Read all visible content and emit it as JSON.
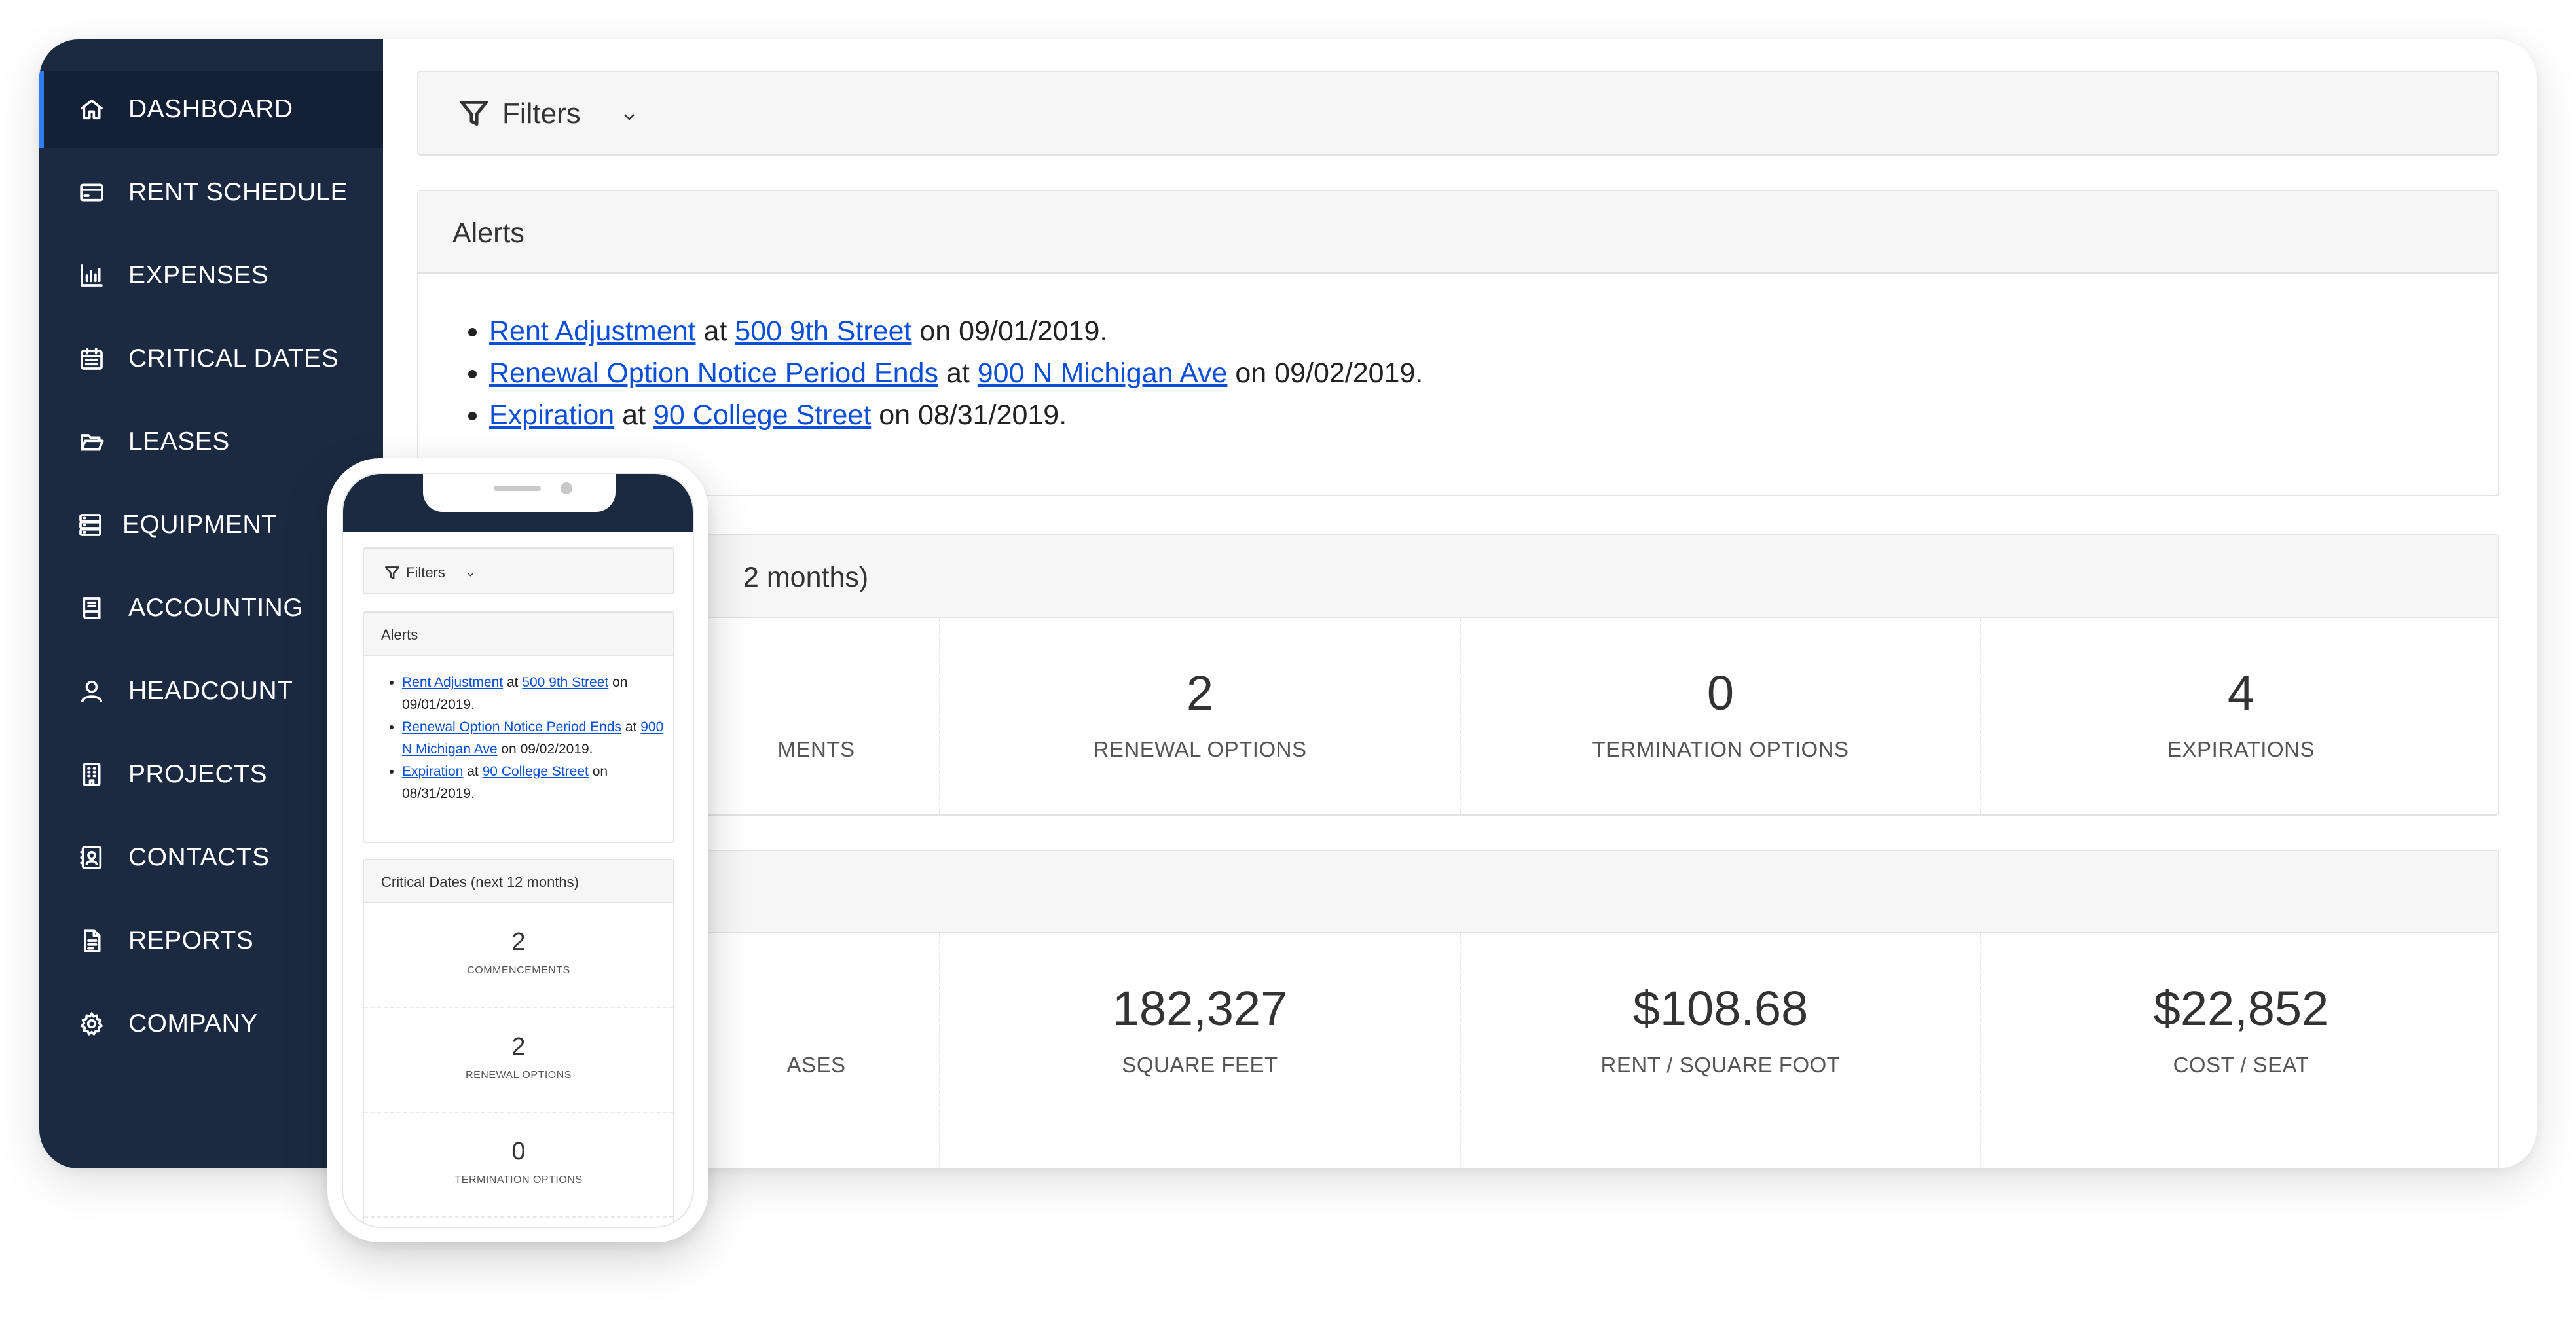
{
  "sidebar": {
    "items": [
      {
        "label": "DASHBOARD",
        "icon": "home-icon",
        "active": true
      },
      {
        "label": "RENT SCHEDULE",
        "icon": "credit-card-icon"
      },
      {
        "label": "EXPENSES",
        "icon": "bar-chart-icon"
      },
      {
        "label": "CRITICAL DATES",
        "icon": "calendar-icon"
      },
      {
        "label": "LEASES",
        "icon": "folder-open-icon"
      },
      {
        "label": "EQUIPMENT",
        "icon": "server-icon"
      },
      {
        "label": "ACCOUNTING",
        "icon": "ledger-icon"
      },
      {
        "label": "HEADCOUNT",
        "icon": "user-icon"
      },
      {
        "label": "PROJECTS",
        "icon": "building-icon"
      },
      {
        "label": "CONTACTS",
        "icon": "contact-card-icon"
      },
      {
        "label": "REPORTS",
        "icon": "document-icon"
      },
      {
        "label": "COMPANY",
        "icon": "gear-icon"
      }
    ],
    "active_color": "#2f7bf0",
    "background": "#1c2a41"
  },
  "filters": {
    "label": "Filters"
  },
  "alerts": {
    "title": "Alerts",
    "items": [
      {
        "type": "Rent Adjustment",
        "joiner": "at",
        "location": "500 9th Street",
        "date_text": "on 09/01/2019."
      },
      {
        "type": "Renewal Option Notice Period Ends",
        "joiner": "at",
        "location": "900 N Michigan Ave",
        "date_text": "on 09/02/2019."
      },
      {
        "type": "Expiration",
        "joiner": "at",
        "location": "90 College Street",
        "date_text": "on 08/31/2019."
      }
    ]
  },
  "critical_dates": {
    "title_visible": "2 months)",
    "stats": [
      {
        "value": "",
        "label": "MENTS"
      },
      {
        "value": "2",
        "label": "RENEWAL OPTIONS"
      },
      {
        "value": "0",
        "label": "TERMINATION OPTIONS"
      },
      {
        "value": "4",
        "label": "EXPIRATIONS"
      }
    ]
  },
  "portfolio": {
    "stats": [
      {
        "value": "",
        "label": "ASES"
      },
      {
        "value": "182,327",
        "label": "SQUARE FEET"
      },
      {
        "value": "$108.68",
        "label": "RENT / SQUARE FOOT"
      },
      {
        "value": "$22,852",
        "label": "COST / SEAT"
      }
    ]
  },
  "mobile": {
    "filters_label": "Filters",
    "alerts_title": "Alerts",
    "alerts": [
      {
        "type": "Rent Adjustment",
        "joiner": "at",
        "location": "500 9th Street",
        "date_text": "on 09/01/2019."
      },
      {
        "type": "Renewal Option Notice Period Ends",
        "joiner": "at",
        "location": "900 N Michigan Ave",
        "date_text": "on 09/02/2019."
      },
      {
        "type": "Expiration",
        "joiner": "at",
        "location": "90 College Street",
        "date_text": "on 08/31/2019."
      }
    ],
    "critical_title": "Critical Dates (next 12 months)",
    "critical_stats": [
      {
        "value": "2",
        "label": "COMMENCEMENTS"
      },
      {
        "value": "2",
        "label": "RENEWAL OPTIONS"
      },
      {
        "value": "0",
        "label": "TERMINATION OPTIONS"
      }
    ]
  }
}
